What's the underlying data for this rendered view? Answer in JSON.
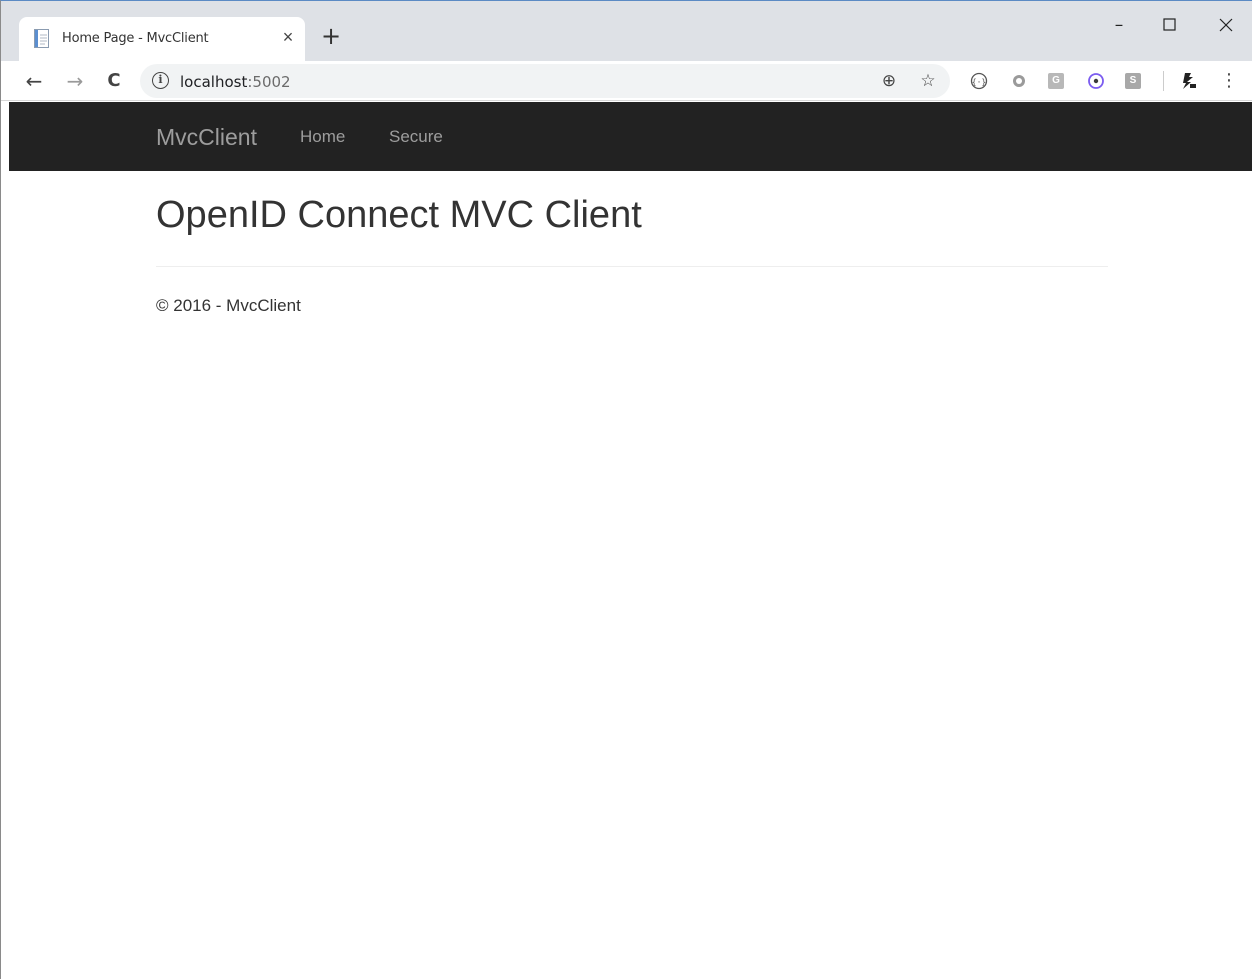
{
  "browser": {
    "tab": {
      "title": "Home Page - MvcClient",
      "close_glyph": "×",
      "favicon": "page-icon"
    },
    "new_tab_glyph": "+",
    "window_controls": {
      "minimize": "–",
      "maximize": "☐",
      "close": "✕"
    },
    "nav": {
      "back": "←",
      "forward": "→",
      "reload": "C"
    },
    "address": {
      "host": "localhost",
      "port": ":5002",
      "info_glyph": "i"
    },
    "omnibox_icons": {
      "zoom": "⊕",
      "bookmark": "☆"
    },
    "extensions": {
      "ext_g_label": "G",
      "ext_s_label": "S"
    },
    "menu_glyph": "⋮"
  },
  "site": {
    "brand": "MvcClient",
    "nav": {
      "home": "Home",
      "secure": "Secure"
    },
    "heading": "OpenID Connect MVC Client",
    "footer": "© 2016 - MvcClient"
  },
  "colors": {
    "navbar_bg": "#222222",
    "nav_text": "#9d9d9d",
    "heading_text": "#333333",
    "tabstrip_bg": "#dee1e6"
  }
}
